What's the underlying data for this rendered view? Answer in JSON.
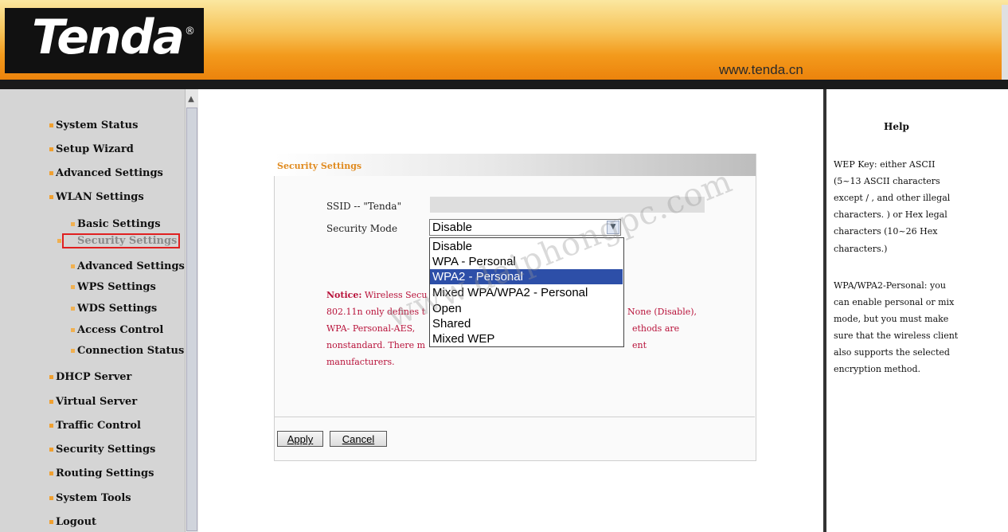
{
  "header": {
    "logo": "Tenda",
    "logo_mark": "®",
    "url": "www.tenda.cn"
  },
  "nav": {
    "items": [
      {
        "label": "System Status"
      },
      {
        "label": "Setup Wizard"
      },
      {
        "label": "Advanced Settings"
      },
      {
        "label": "WLAN Settings"
      },
      {
        "label": "Basic Settings"
      },
      {
        "label": "Security Settings"
      },
      {
        "label": "Advanced Settings"
      },
      {
        "label": "WPS Settings"
      },
      {
        "label": "WDS Settings"
      },
      {
        "label": "Access Control"
      },
      {
        "label": "Connection Status"
      },
      {
        "label": "DHCP Server"
      },
      {
        "label": "Virtual Server"
      },
      {
        "label": "Traffic Control"
      },
      {
        "label": "Security Settings"
      },
      {
        "label": "Routing Settings"
      },
      {
        "label": "System Tools"
      },
      {
        "label": "Logout"
      }
    ],
    "scroll_up_icon": "▲"
  },
  "main": {
    "panel_title": "Security Settings",
    "ssid_label": "SSID -- \"Tenda\"",
    "security_mode_label": "Security Mode",
    "security_mode_value": "Disable",
    "dropdown_arrow": "▼",
    "options": [
      "Disable",
      "WPA - Personal",
      "WPA2 - Personal",
      "Mixed WPA/WPA2 - Personal",
      "Open",
      "Shared",
      "Mixed WEP"
    ],
    "selected_option": "WPA2 - Personal",
    "notice": {
      "label": "Notice:",
      "line1": "Wireless Secu",
      "line1_right": "",
      "line2_left": "802.11n only defines t",
      "line2_right": "None (Disable),",
      "line3_left": "WPA- Personal-AES,",
      "line3_right": "ethods are",
      "line4_left": "nonstandard. There m",
      "line4_right": "ent",
      "line5": "manufacturers."
    },
    "apply_button": "Apply",
    "cancel_button": "Cancel"
  },
  "help": {
    "title": "Help",
    "lines": [
      "WEP Key: either ASCII",
      "(5~13 ASCII characters",
      "except / , and other illegal",
      "characters. ) or Hex legal",
      "characters (10~26 Hex",
      "characters.)",
      "",
      "WPA/WPA2-Personal: you",
      "can enable personal or mix",
      "mode, but you must make",
      "sure that the wireless client",
      "also supports the selected",
      "encryption method."
    ]
  },
  "watermark": "www.daiphongpc.com",
  "colors": {
    "header_orange": "#f39a1c",
    "panel_title": "#e08a1e",
    "notice": "#b8123a",
    "selection": "#2d4fa8",
    "active_border": "#e02020"
  }
}
